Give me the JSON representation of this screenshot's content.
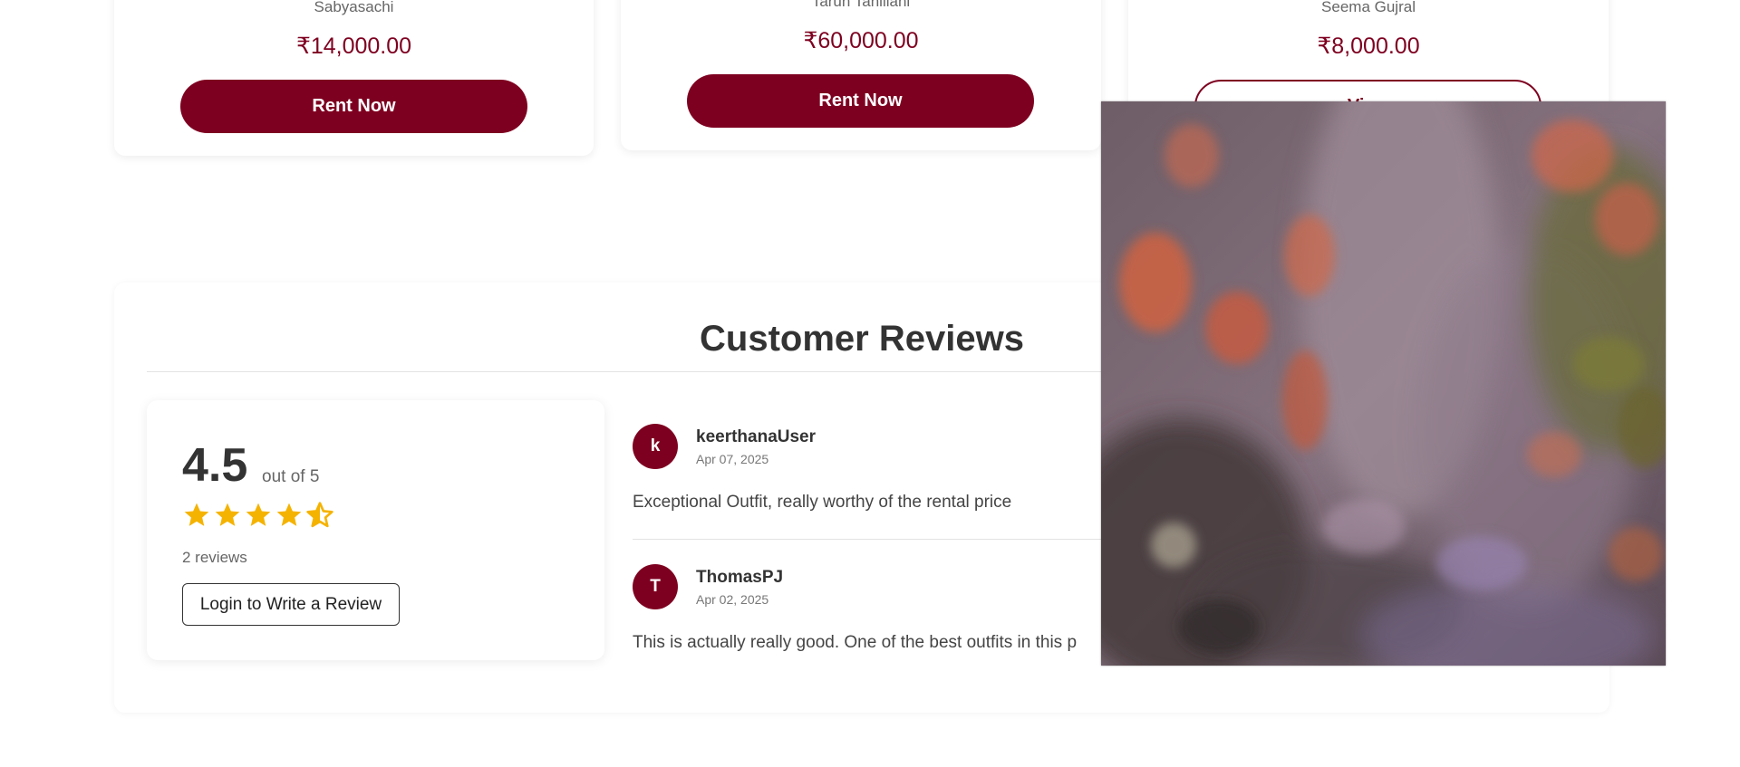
{
  "products": [
    {
      "designer": "Sabyasachi",
      "price": "₹14,000.00",
      "button": "Rent Now"
    },
    {
      "designer": "Tarun Tahiliani",
      "price": "₹60,000.00",
      "button": "Rent Now"
    },
    {
      "designer": "Seema Gujral",
      "price": "₹8,000.00",
      "button": "View"
    }
  ],
  "reviews": {
    "title": "Customer Reviews",
    "rating": "4.5",
    "out_of": "out of 5",
    "stars": 4.5,
    "count": "2 reviews",
    "login_button": "Login to Write a Review",
    "star_color": "#f5b301",
    "items": [
      {
        "initial": "k",
        "name": "keerthanaUser",
        "date": "Apr 07, 2025",
        "text": "Exceptional Outfit, really worthy of the rental price"
      },
      {
        "initial": "T",
        "name": "ThomasPJ",
        "date": "Apr 02, 2025",
        "text": "This is actually really good. One of the best outfits in this p"
      }
    ]
  },
  "colors": {
    "brand": "#7e0020"
  }
}
